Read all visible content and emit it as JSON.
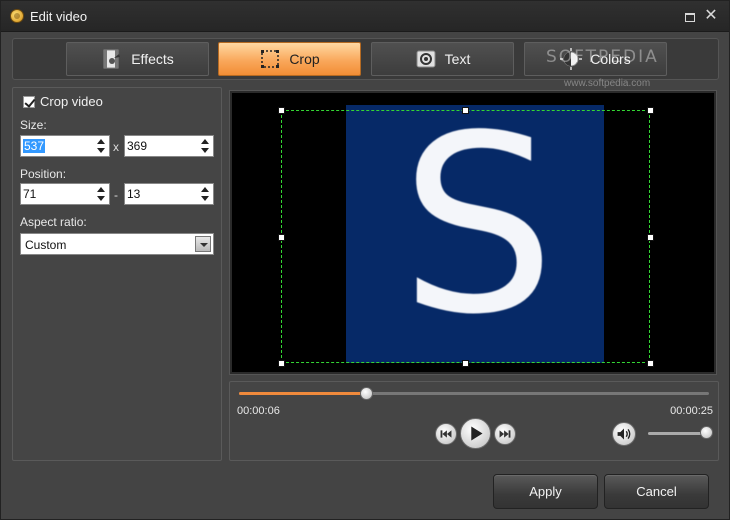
{
  "window": {
    "title": "Edit video"
  },
  "tabs": [
    {
      "label": "Effects",
      "icon": "effects-icon"
    },
    {
      "label": "Crop",
      "icon": "crop-icon",
      "active": true
    },
    {
      "label": "Text",
      "icon": "text-icon"
    },
    {
      "label": "Colors",
      "icon": "colors-icon"
    }
  ],
  "watermark": {
    "main": "SOFTPEDIA",
    "sub": "www.softpedia.com"
  },
  "crop": {
    "enable_label": "Crop video",
    "enabled": true,
    "size_label": "Size:",
    "width": "537",
    "height": "369",
    "size_separator": "x",
    "position_label": "Position:",
    "pos_x": "71",
    "pos_y": "13",
    "position_separator": "-",
    "aspect_label": "Aspect ratio:",
    "aspect_value": "Custom"
  },
  "preview": {
    "letter": "S"
  },
  "playback": {
    "current_time": "00:00:06",
    "total_time": "00:00:25",
    "progress": 0.27,
    "volume": 1.0
  },
  "buttons": {
    "apply": "Apply",
    "cancel": "Cancel"
  },
  "colors": {
    "accent": "#f28d35",
    "crop_guide": "#33d633",
    "video_bg": "#062967"
  }
}
